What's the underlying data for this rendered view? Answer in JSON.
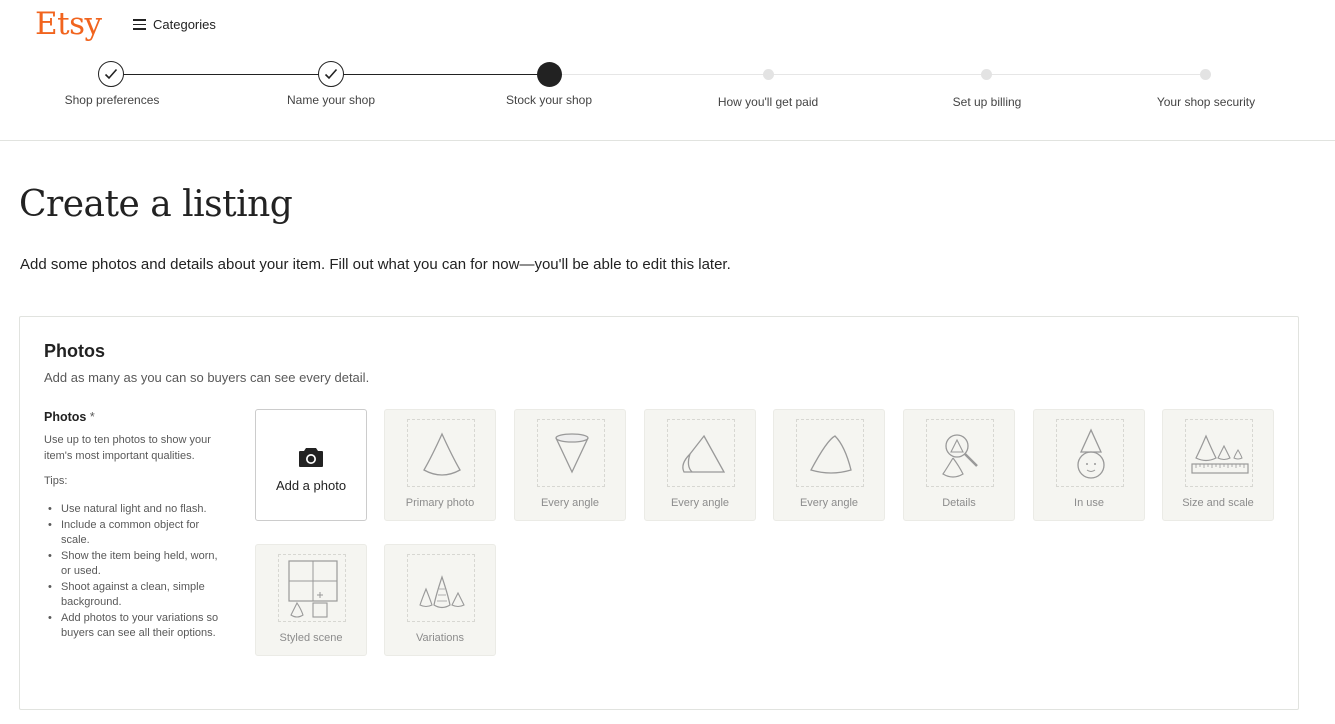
{
  "header": {
    "logo": "Etsy",
    "categories_label": "Categories"
  },
  "stepper": {
    "steps": [
      {
        "label": "Shop preferences",
        "state": "done"
      },
      {
        "label": "Name your shop",
        "state": "done"
      },
      {
        "label": "Stock your shop",
        "state": "current"
      },
      {
        "label": "How you'll get paid",
        "state": "todo"
      },
      {
        "label": "Set up billing",
        "state": "todo"
      },
      {
        "label": "Your shop security",
        "state": "todo"
      }
    ]
  },
  "page": {
    "title": "Create a listing",
    "subtitle": "Add some photos and details about your item. Fill out what you can for now—you'll be able to edit this later."
  },
  "photos": {
    "title": "Photos",
    "description": "Add as many as you can so buyers can see every detail.",
    "field_label": "Photos",
    "required_mark": "*",
    "help": "Use up to ten photos to show your item's most important qualities.",
    "tips_label": "Tips:",
    "tips": [
      "Use natural light and no flash.",
      "Include a common object for scale.",
      "Show the item being held, worn, or used.",
      "Shoot against a clean, simple background.",
      "Add photos to your variations so buyers can see all their options."
    ],
    "add_label": "Add a photo",
    "slots": [
      {
        "label": "Primary photo",
        "icon": "cone-icon"
      },
      {
        "label": "Every angle",
        "icon": "cone-top-icon"
      },
      {
        "label": "Every angle",
        "icon": "cone-side-icon"
      },
      {
        "label": "Every angle",
        "icon": "cone-rotated-icon"
      },
      {
        "label": "Details",
        "icon": "magnifier-icon"
      },
      {
        "label": "In use",
        "icon": "person-cone-icon"
      },
      {
        "label": "Size and scale",
        "icon": "ruler-icon"
      },
      {
        "label": "Styled scene",
        "icon": "window-scene-icon"
      },
      {
        "label": "Variations",
        "icon": "variations-icon"
      }
    ]
  },
  "colors": {
    "brand": "#f1641e",
    "text": "#222222",
    "muted": "#595959",
    "tile_bg": "#f5f5f1"
  }
}
